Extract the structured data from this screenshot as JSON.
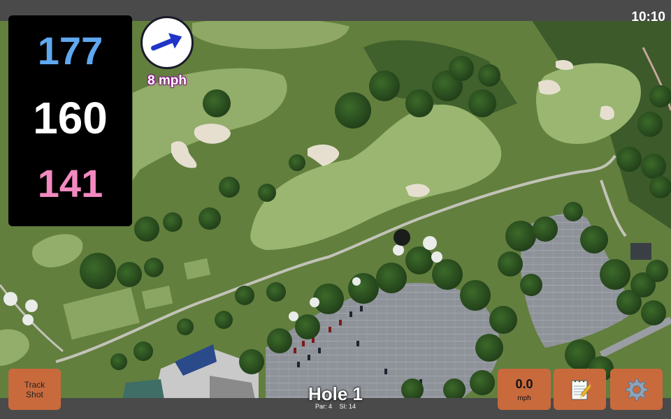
{
  "status_bar": {
    "time": "10:10"
  },
  "distances": {
    "back": {
      "value": "177",
      "color": "#5fa8ef"
    },
    "middle": {
      "value": "160",
      "color": "#ffffff"
    },
    "front": {
      "value": "141",
      "color": "#f28ac0"
    }
  },
  "wind": {
    "speed": "8 mph",
    "arrow_icon": "wind-direction-arrow",
    "arrow_color": "#1f35c8"
  },
  "buttons": {
    "track_shot_line1": "Track",
    "track_shot_line2": "Shot",
    "speed_value": "0.0",
    "speed_unit": "mph",
    "notes_icon": "notepad-icon",
    "settings_icon": "gear-icon",
    "accent": "#c96a3d"
  },
  "hole": {
    "title": "Hole 1",
    "par": "Par: 4",
    "si": "SI: 14"
  }
}
